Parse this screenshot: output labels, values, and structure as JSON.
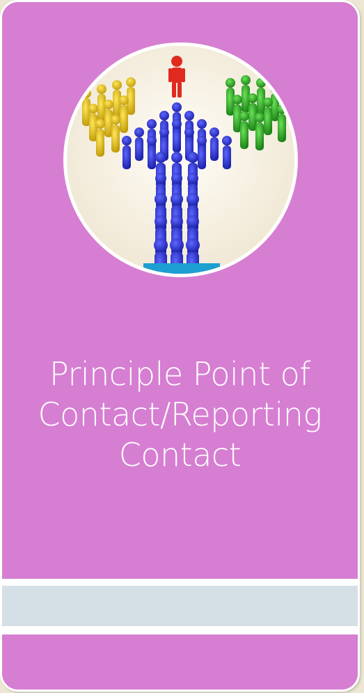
{
  "title": {
    "line1": "Principle Point of",
    "line2": "Contact/Reporting",
    "line3": "Contact"
  },
  "colors": {
    "card": "#d67ed2",
    "band": "#d5e0e6",
    "border": "#ffffff",
    "leader": "#e02a1f",
    "arrow": "#2a33c7",
    "left_group": "#e3c21e",
    "right_group": "#2fae24"
  },
  "image": {
    "icon": "team-arrow-leader-image"
  }
}
